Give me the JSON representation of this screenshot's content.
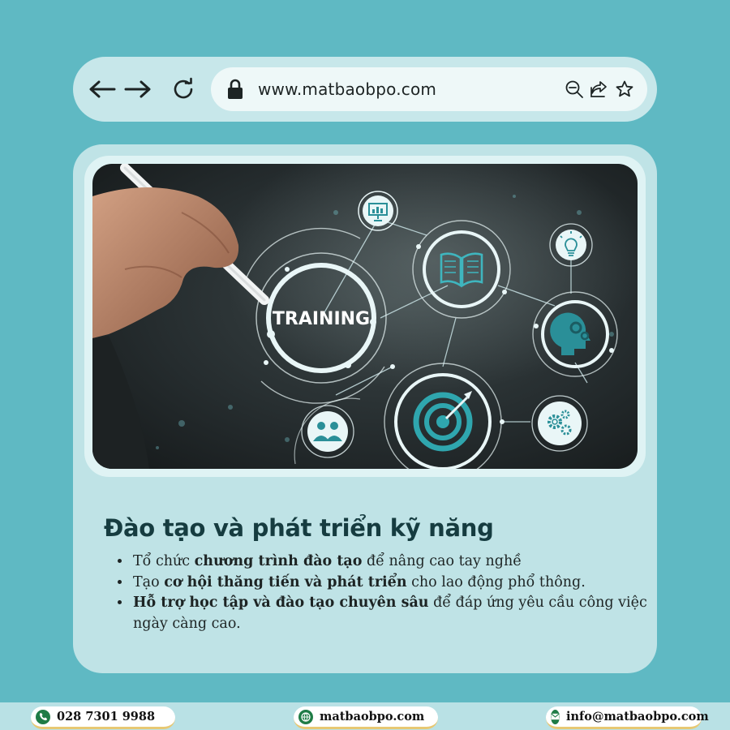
{
  "browser": {
    "url": "www.matbaobpo.com",
    "icons": [
      "back-arrow-icon",
      "forward-arrow-icon",
      "reload-icon",
      "lock-icon",
      "zoom-out-icon",
      "share-icon",
      "star-icon"
    ]
  },
  "photo": {
    "center_label": "TRAINING",
    "icons": [
      "presentation-icon",
      "book-icon",
      "lightbulb-icon",
      "head-gears-icon",
      "target-icon",
      "gears-icon",
      "team-icon"
    ]
  },
  "content": {
    "heading": "Đào tạo và phát triển kỹ năng",
    "bullets": [
      {
        "pre": "Tổ chức ",
        "bold": "chương trình đào tạo",
        "post": " để nâng cao tay nghề"
      },
      {
        "pre": "Tạo ",
        "bold": "cơ hội thăng tiến và phát triển",
        "post": " cho lao động phổ thông."
      },
      {
        "pre": "",
        "bold": "Hỗ trợ học tập và đào tạo chuyên sâu",
        "post": " để đáp ứng yêu cầu công việc ngày càng cao."
      }
    ]
  },
  "footer": {
    "phone": "028 7301 9988",
    "website": "matbaobpo.com",
    "email": "info@matbaobpo.com"
  },
  "colors": {
    "background": "#5fb9c3",
    "card": "#bfe3e6",
    "heading": "#163c40",
    "accent_gold": "#e7c873",
    "icon_green": "#1f7c46",
    "photo_teal": "#2a8f98"
  }
}
